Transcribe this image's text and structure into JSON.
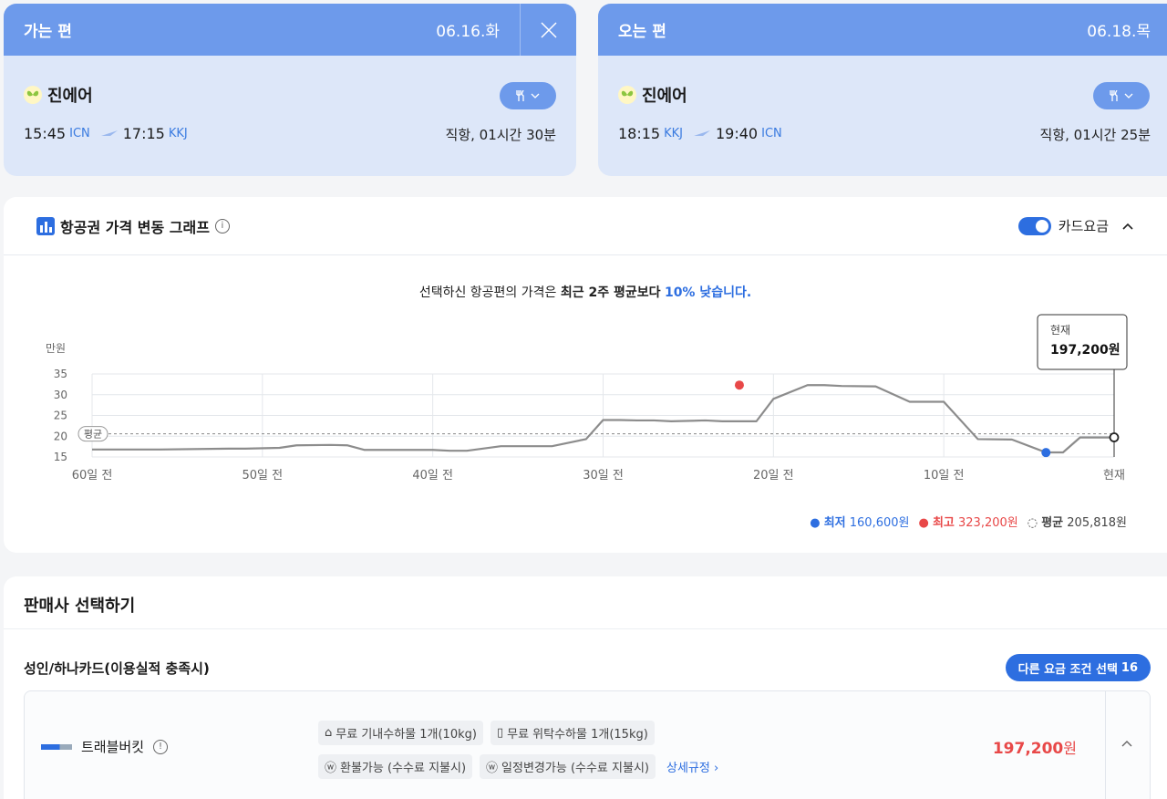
{
  "outbound": {
    "heading": "가는 편",
    "date": "06.16.화",
    "airline": "진에어",
    "dep_time": "15:45",
    "dep_code": "ICN",
    "arr_time": "17:15",
    "arr_code": "KKJ",
    "duration": "직항, 01시간 30분",
    "icons": [
      "close-icon",
      "meal-icon",
      "chevron-down-icon",
      "plane-icon",
      "butterfly-logo"
    ]
  },
  "inbound": {
    "heading": "오는 편",
    "date": "06.18.목",
    "airline": "진에어",
    "dep_time": "18:15",
    "dep_code": "KKJ",
    "arr_time": "19:40",
    "arr_code": "ICN",
    "duration": "직항, 01시간 25분"
  },
  "graph": {
    "title": "항공권 가격 변동 그래프",
    "toggle_label": "카드요금",
    "toggle_on": true,
    "summary_prefix": "선택하신 항공편의 가격은 ",
    "summary_bold": "최근 2주 평균보다",
    "summary_highlight": "10% 낮습니다.",
    "tooltip_label": "현재",
    "tooltip_value": "197,200원",
    "legend": {
      "low_label": "최저",
      "low_value": "160,600원",
      "high_label": "최고",
      "high_value": "323,200원",
      "avg_label": "평균",
      "avg_value": "205,818원"
    },
    "colors": {
      "accent": "#2d6ee0",
      "high": "#e84848",
      "line": "#8c8c8c"
    }
  },
  "chart_data": {
    "type": "line",
    "ylabel": "만원",
    "yticks": [
      15,
      20,
      25,
      30,
      35
    ],
    "ylim": [
      15,
      35
    ],
    "xticks": [
      "60일 전",
      "50일 전",
      "40일 전",
      "30일 전",
      "20일 전",
      "10일 전",
      "현재"
    ],
    "avg_label": "평균",
    "average": 20.58,
    "low": {
      "x": 4,
      "y": 16.06,
      "label": "최저"
    },
    "high": {
      "x": 22,
      "y": 32.32,
      "label": "최고"
    },
    "current": {
      "x": 0,
      "y": 19.72,
      "label": "현재"
    },
    "series": [
      {
        "x": [
          60,
          56,
          52,
          51,
          49,
          48,
          46,
          45,
          44,
          40,
          39,
          38,
          36,
          33,
          31,
          30,
          29,
          28,
          27,
          26,
          24,
          23,
          22,
          21,
          20,
          18,
          17,
          16,
          14,
          12,
          11,
          10,
          8,
          6,
          4,
          3,
          2,
          1,
          0
        ],
        "y": [
          16.8,
          16.8,
          17.0,
          17.0,
          17.2,
          17.8,
          17.9,
          17.8,
          16.7,
          16.7,
          16.5,
          16.5,
          17.6,
          17.6,
          19.3,
          23.9,
          23.9,
          23.8,
          23.8,
          23.6,
          23.8,
          23.6,
          23.6,
          23.6,
          29.0,
          32.3,
          32.3,
          32.1,
          32.0,
          28.3,
          28.3,
          28.3,
          19.3,
          19.2,
          16.1,
          16.1,
          19.7,
          19.7,
          19.7
        ]
      }
    ]
  },
  "seller": {
    "title": "판매사 선택하기",
    "fare_condition": "성인/하나카드(이용실적 충족시)",
    "other_fare_label": "다른 요금 조건 선택",
    "other_fare_count": "16",
    "agency_name": "트래블버킷",
    "chips": [
      "무료 기내수하물 1개(10kg)",
      "무료 위탁수하물 1개(15kg)",
      "환불가능 (수수료 지불시)",
      "일정변경가능 (수수료 지불시)"
    ],
    "detail_link": "상세규정",
    "price_num": "197,200",
    "price_unit": "원"
  }
}
